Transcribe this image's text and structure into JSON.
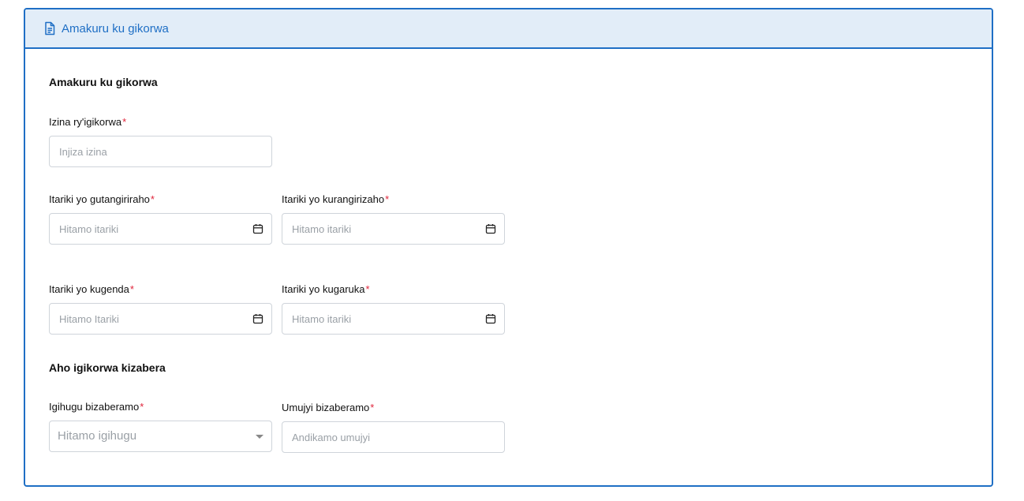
{
  "header": {
    "title": "Amakuru ku gikorwa"
  },
  "sections": {
    "event_info": "Amakuru ku gikorwa",
    "location": "Aho igikorwa kizabera"
  },
  "fields": {
    "event_name": {
      "label": "Izina ry'igikorwa",
      "required": "*",
      "placeholder": "Injiza izina"
    },
    "start_date": {
      "label": "Itariki yo gutangiriraho",
      "required": "*",
      "placeholder": "Hitamo itariki"
    },
    "end_date": {
      "label": "Itariki yo kurangirizaho",
      "required": "*",
      "placeholder": "Hitamo itariki"
    },
    "departure_date": {
      "label": "Itariki yo kugenda",
      "required": "*",
      "placeholder": "Hitamo Itariki"
    },
    "return_date": {
      "label": "Itariki yo kugaruka",
      "required": "*",
      "placeholder": "Hitamo itariki"
    },
    "country": {
      "label": "Igihugu bizaberamo",
      "required": "*",
      "placeholder": "Hitamo igihugu"
    },
    "city": {
      "label": "Umujyi bizaberamo",
      "required": "*",
      "placeholder": "Andikamo umujyi"
    }
  },
  "icons": {
    "header": "document-icon",
    "date": "calendar-icon",
    "select": "caret-down-icon"
  },
  "colors": {
    "accent": "#1f6fc5",
    "header_bg": "#e2edf8",
    "required": "#e0243a",
    "border": "#cfd4da",
    "placeholder": "#9aa0a6"
  }
}
